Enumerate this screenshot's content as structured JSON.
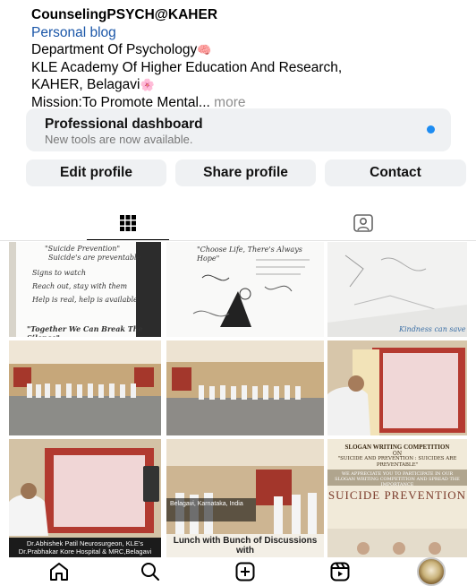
{
  "profile": {
    "name": "CounselingPSYCH@KAHER",
    "link": "Personal blog",
    "line1": "Department Of Psychology",
    "line2": "KLE Academy Of Higher Education And Research,",
    "line3": "KAHER, Belagavi",
    "line4": "Mission:To Promote Mental...",
    "more": "more",
    "emoji_brain": "🧠",
    "emoji_flower": "🌸"
  },
  "dashboard": {
    "title": "Professional dashboard",
    "subtitle": "New tools are now available."
  },
  "buttons": {
    "edit": "Edit profile",
    "share": "Share profile",
    "contact": "Contact"
  },
  "tabs": {
    "grid_icon": "grid-icon",
    "tagged_icon": "tagged-person-icon"
  },
  "posts": {
    "p1": {
      "title": "\"Suicide Prevention\"",
      "line1": "Suicide's are preventable",
      "line2": "Signs to watch",
      "line3": "Reach out, stay with them",
      "line4": "Help is real, help is available",
      "footer": "\"Together We Can Break The Silence\""
    },
    "p2": {
      "title": "\"Choose Life, There's Always Hope\""
    },
    "p3": {
      "footer": "Kindness can save"
    },
    "p7": {
      "caption": "Dr.Abhishek Patil Neurosurgeon, KLE's Dr.Prabhakar Kore Hospital & MRC,Belagavi"
    },
    "p8": {
      "location": "Belagavi, Karnataka, India",
      "caption": "Lunch with Bunch of Discussions with"
    },
    "p9": {
      "heading": "SLOGAN WRITING COMPETITION",
      "subheading": "ON",
      "theme": "\"SUICIDE AND PREVENTION : SUICIDES ARE PREVENTABLE\"",
      "banner": "WE APPRECIATE YOU TO PARTICIPATE IN OUR SLOGAN WRITING COMPETITION AND SPREAD THE IMPORTANCE",
      "big": "SUICIDE PREVENTION"
    }
  },
  "nav": {
    "home": "home-icon",
    "search": "search-icon",
    "create": "create-post-icon",
    "reels": "reels-icon",
    "profile": "profile-avatar"
  },
  "colors": {
    "link": "#1a56a8",
    "dot": "#1d8cf2",
    "button_bg": "#eff1f3",
    "muted": "#8e8e8e"
  }
}
